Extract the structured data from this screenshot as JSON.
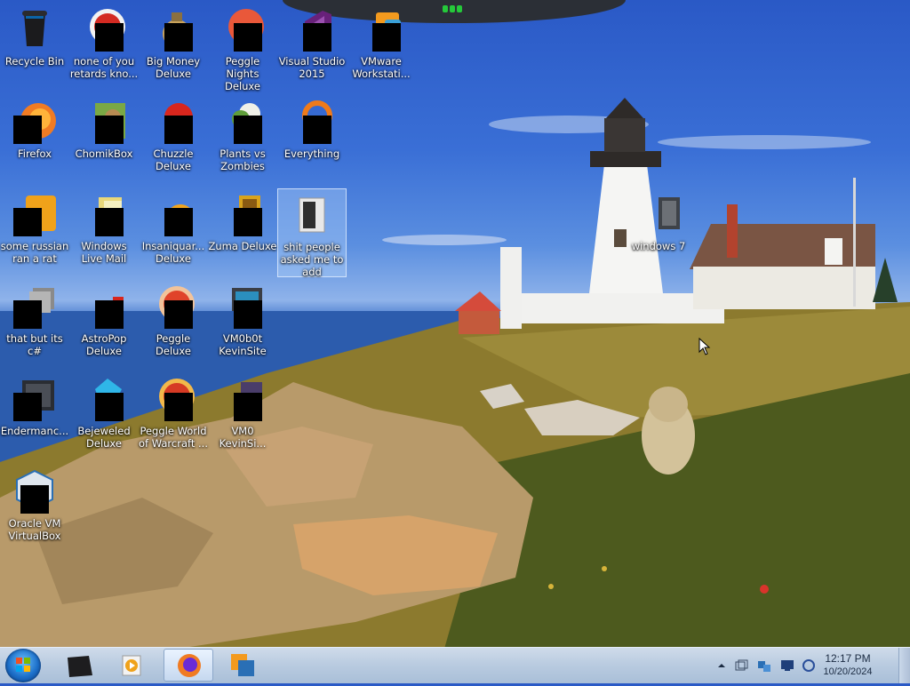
{
  "desktop": {
    "icons": [
      {
        "label": "Recycle Bin"
      },
      {
        "label": "none of you retards kno..."
      },
      {
        "label": "Big Money Deluxe"
      },
      {
        "label": "Peggle Nights Deluxe"
      },
      {
        "label": "Visual Studio 2015"
      },
      {
        "label": "VMware Workstati..."
      },
      {
        "label": "Firefox"
      },
      {
        "label": "ChomikBox"
      },
      {
        "label": "Chuzzle Deluxe"
      },
      {
        "label": "Plants vs Zombies"
      },
      {
        "label": "Everything"
      },
      {
        "label": "some russian ran a rat"
      },
      {
        "label": "Windows Live Mail"
      },
      {
        "label": "Insaniquar... Deluxe"
      },
      {
        "label": "Zuma Deluxe"
      },
      {
        "label": "shit people asked me to add"
      },
      {
        "label": "windows 7"
      },
      {
        "label": "that but its c#"
      },
      {
        "label": "AstroPop Deluxe"
      },
      {
        "label": "Peggle Deluxe"
      },
      {
        "label": "VM0b0t KevinSite"
      },
      {
        "label": "Endermanc..."
      },
      {
        "label": "Bejeweled Deluxe"
      },
      {
        "label": "Peggle World of Warcraft ..."
      },
      {
        "label": "VM0 KevinSi..."
      },
      {
        "label": "Oracle VM VirtualBox"
      }
    ]
  },
  "taskbar": {
    "clock_time": "12:17 PM",
    "clock_date": "10/20/2024"
  },
  "colors": {
    "taskbar": "#b9cbe0",
    "selection": "#bedcff"
  }
}
